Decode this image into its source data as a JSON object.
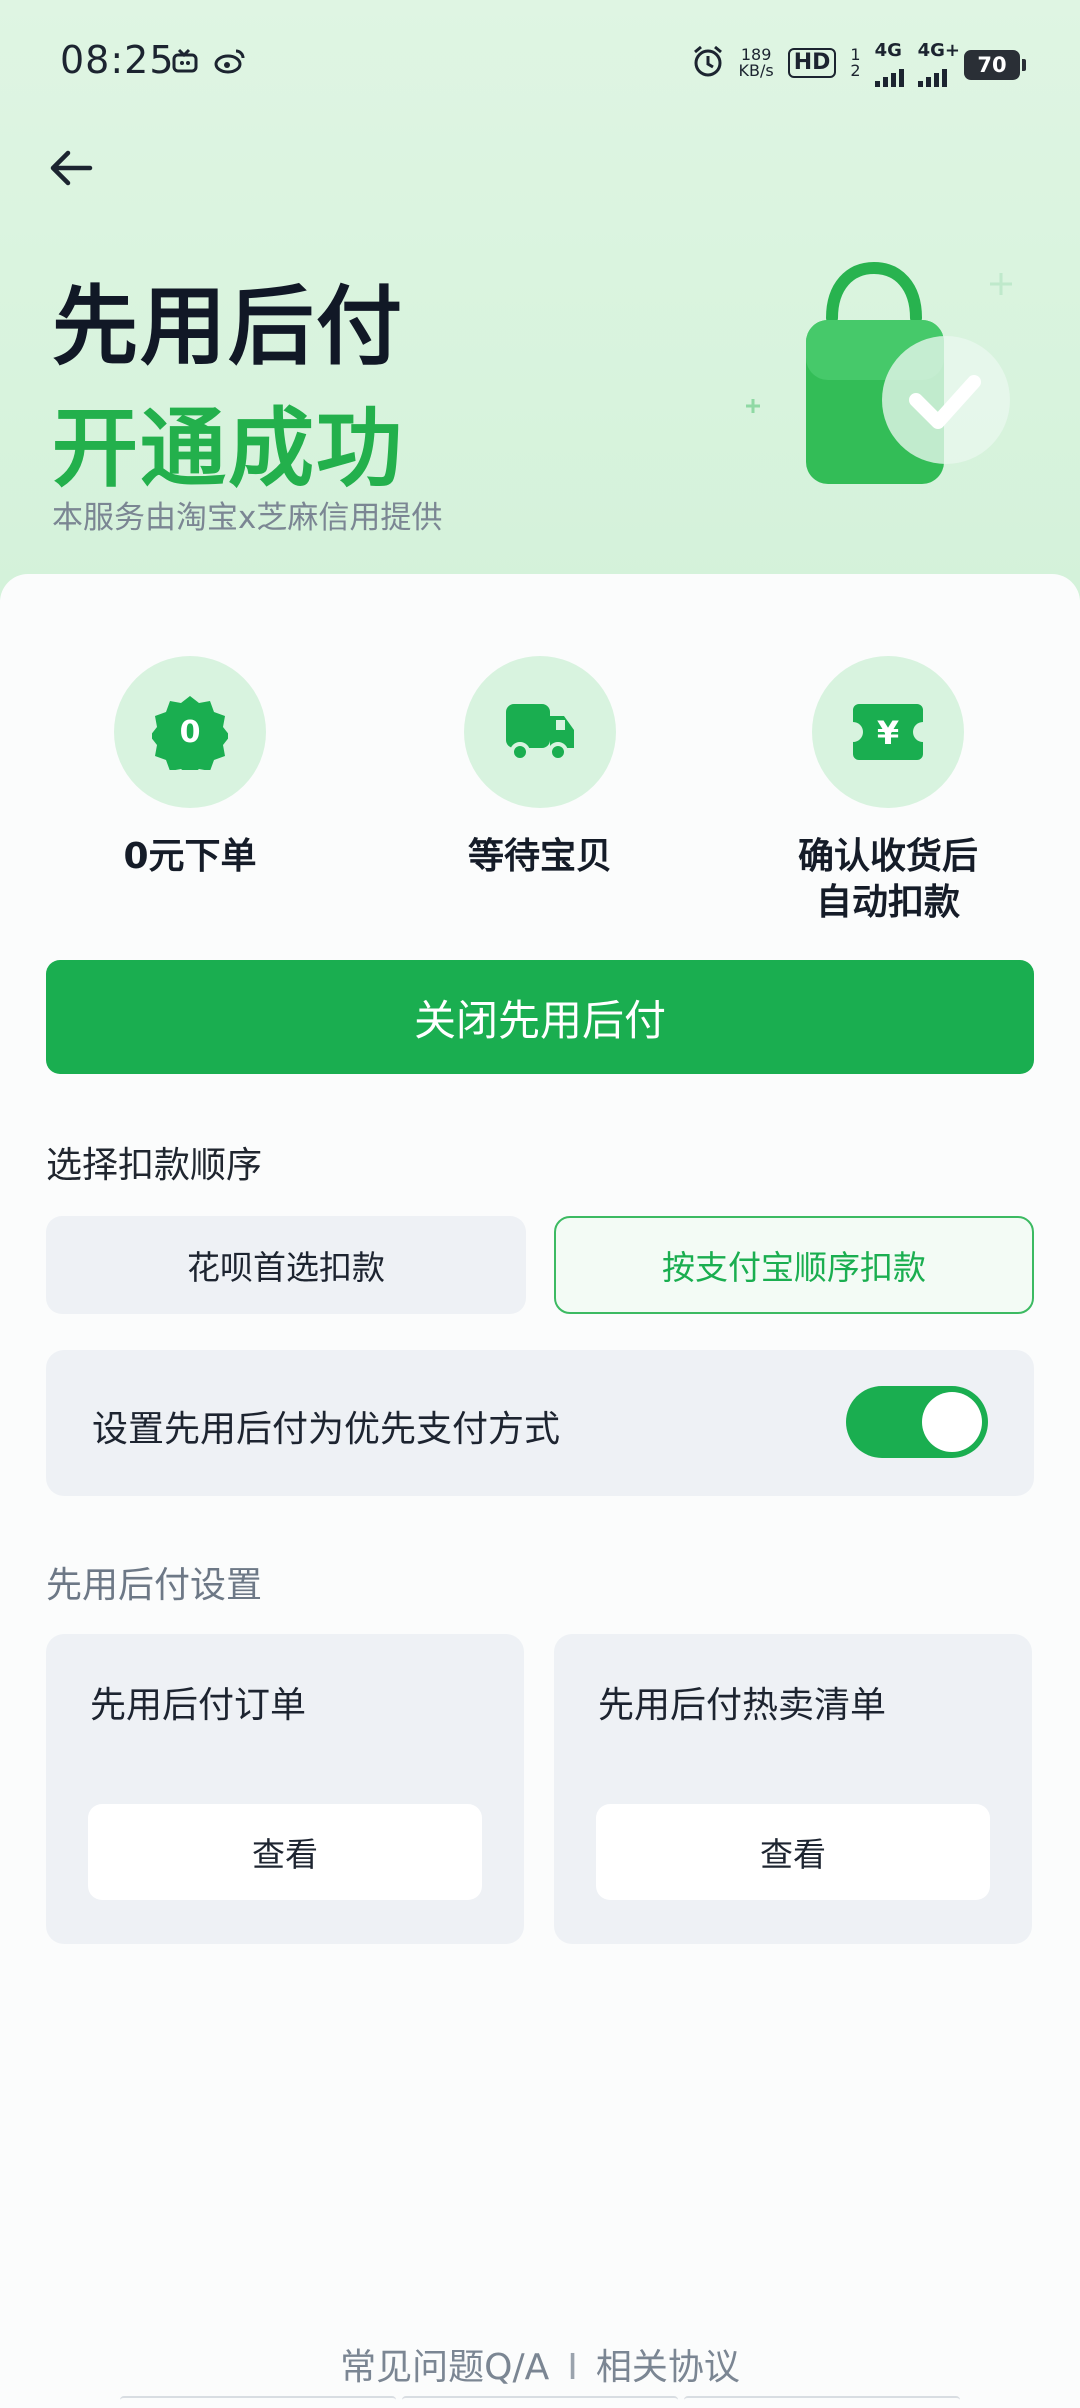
{
  "status_bar": {
    "time": "08:25",
    "net_speed_value": "189",
    "net_speed_unit": "KB/s",
    "hd_label": "HD",
    "sim1": "1",
    "sim2": "2",
    "net1": "4G",
    "net2": "4G+",
    "battery": "70"
  },
  "header": {
    "title": "先用后付",
    "subtitle": "开通成功",
    "note": "本服务由淘宝x芝麻信用提供"
  },
  "steps": [
    {
      "icon": "zero-badge-icon",
      "badge_text": "0",
      "label": "0元下单"
    },
    {
      "icon": "truck-icon",
      "label": "等待宝贝"
    },
    {
      "icon": "yen-ticket-icon",
      "badge_text": "¥",
      "label_line1": "确认收货后",
      "label_line2": "自动扣款"
    }
  ],
  "close_button": {
    "label": "关闭先用后付"
  },
  "deduction": {
    "section_label": "选择扣款顺序",
    "options": [
      {
        "label": "花呗首选扣款",
        "selected": false
      },
      {
        "label": "按支付宝顺序扣款",
        "selected": true
      }
    ]
  },
  "preference": {
    "label": "设置先用后付为优先支付方式",
    "enabled": true
  },
  "settings": {
    "section_label": "先用后付设置",
    "tiles": [
      {
        "title": "先用后付订单",
        "button": "查看"
      },
      {
        "title": "先用后付热卖清单",
        "button": "查看"
      }
    ]
  },
  "footer": {
    "faq": "常见问题Q/A",
    "separator": "I",
    "agreement": "相关协议"
  },
  "colors": {
    "brand_green": "#1aae50",
    "hero_bg": "#dff5e3",
    "title_dark": "#111826"
  }
}
